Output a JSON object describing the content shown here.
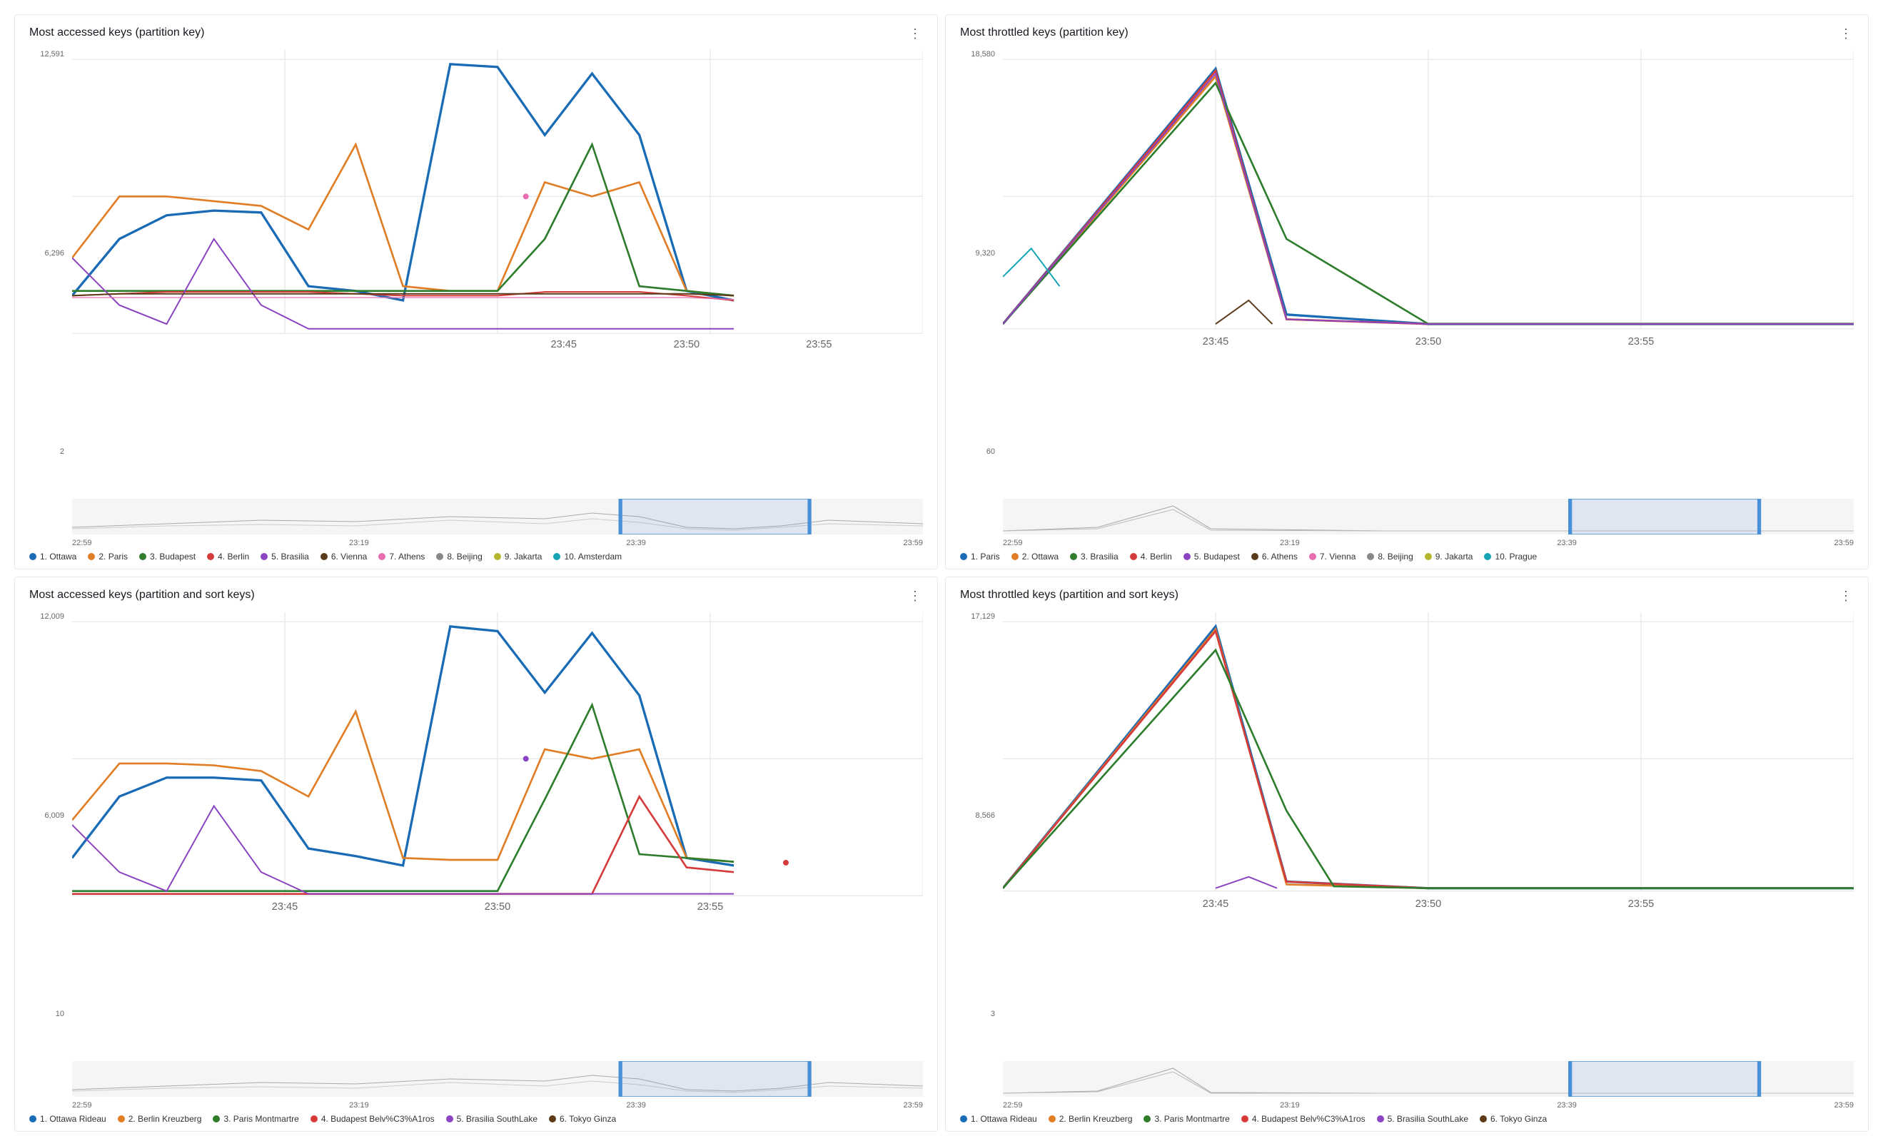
{
  "panels": [
    {
      "id": "panel-top-left",
      "title": "Most accessed keys (partition key)",
      "menu_icon": "⋮",
      "y_axis": [
        "12,591",
        "6,296",
        "2"
      ],
      "x_axis": [
        "22:59",
        "23:19",
        "23:39",
        "23:59"
      ],
      "x_mid": [
        "23:45",
        "23:50",
        "23:55"
      ],
      "legend": [
        {
          "label": "1. Ottawa",
          "color": "#1a6bb5",
          "shape": "dot"
        },
        {
          "label": "2. Paris",
          "color": "#e07d25",
          "shape": "dot"
        },
        {
          "label": "3. Budapest",
          "color": "#2d7d2d",
          "shape": "dot"
        },
        {
          "label": "4. Berlin",
          "color": "#d63b3b",
          "shape": "dot"
        },
        {
          "label": "5. Brasilia",
          "color": "#8b44c1",
          "shape": "dot"
        },
        {
          "label": "6. Vienna",
          "color": "#5c3a1a",
          "shape": "dot"
        },
        {
          "label": "7. Athens",
          "color": "#e86cb0",
          "shape": "dot"
        },
        {
          "label": "8. Beijing",
          "color": "#888",
          "shape": "dot"
        },
        {
          "label": "9. Jakarta",
          "color": "#b5b52d",
          "shape": "dot"
        },
        {
          "label": "10. Amsterdam",
          "color": "#17a5b5",
          "shape": "dot"
        }
      ]
    },
    {
      "id": "panel-top-right",
      "title": "Most throttled keys (partition key)",
      "menu_icon": "⋮",
      "y_axis": [
        "18,580",
        "9,320",
        "60"
      ],
      "x_axis": [
        "22:59",
        "23:19",
        "23:39",
        "23:59"
      ],
      "x_mid": [
        "23:45",
        "23:50",
        "23:55"
      ],
      "legend": [
        {
          "label": "1. Paris",
          "color": "#1a6bb5",
          "shape": "dot"
        },
        {
          "label": "2. Ottawa",
          "color": "#e07d25",
          "shape": "dot"
        },
        {
          "label": "3. Brasilia",
          "color": "#2d7d2d",
          "shape": "dot"
        },
        {
          "label": "4. Berlin",
          "color": "#d63b3b",
          "shape": "dot"
        },
        {
          "label": "5. Budapest",
          "color": "#8b44c1",
          "shape": "dot"
        },
        {
          "label": "6. Athens",
          "color": "#5c3a1a",
          "shape": "dot"
        },
        {
          "label": "7. Vienna",
          "color": "#e86cb0",
          "shape": "dot"
        },
        {
          "label": "8. Beijing",
          "color": "#888",
          "shape": "dot"
        },
        {
          "label": "9. Jakarta",
          "color": "#b5b52d",
          "shape": "dot"
        },
        {
          "label": "10. Prague",
          "color": "#17a5b5",
          "shape": "dot"
        }
      ]
    },
    {
      "id": "panel-bottom-left",
      "title": "Most accessed keys (partition and sort keys)",
      "menu_icon": "⋮",
      "y_axis": [
        "12,009",
        "6,009",
        "10"
      ],
      "x_axis": [
        "22:59",
        "23:19",
        "23:39",
        "23:59"
      ],
      "x_mid": [
        "23:45",
        "23:50",
        "23:55"
      ],
      "legend": [
        {
          "label": "1. Ottawa Rideau",
          "color": "#1a6bb5",
          "shape": "dot"
        },
        {
          "label": "2. Berlin Kreuzberg",
          "color": "#e07d25",
          "shape": "dot"
        },
        {
          "label": "3. Paris Montmartre",
          "color": "#2d7d2d",
          "shape": "dot"
        },
        {
          "label": "4. Budapest Belv%C3%A1ros",
          "color": "#d63b3b",
          "shape": "dot"
        },
        {
          "label": "5. Brasilia SouthLake",
          "color": "#8b44c1",
          "shape": "dot"
        },
        {
          "label": "6. Tokyo Ginza",
          "color": "#5c3a1a",
          "shape": "dot"
        }
      ]
    },
    {
      "id": "panel-bottom-right",
      "title": "Most throttled keys (partition and sort keys)",
      "menu_icon": "⋮",
      "y_axis": [
        "17,129",
        "8,566",
        "3"
      ],
      "x_axis": [
        "22:59",
        "23:19",
        "23:39",
        "23:59"
      ],
      "x_mid": [
        "23:45",
        "23:50",
        "23:55"
      ],
      "legend": [
        {
          "label": "1. Ottawa Rideau",
          "color": "#1a6bb5",
          "shape": "dot"
        },
        {
          "label": "2. Berlin Kreuzberg",
          "color": "#e07d25",
          "shape": "dot"
        },
        {
          "label": "3. Paris Montmartre",
          "color": "#2d7d2d",
          "shape": "dot"
        },
        {
          "label": "4. Budapest Belv%C3%A1ros",
          "color": "#d63b3b",
          "shape": "dot"
        },
        {
          "label": "5. Brasilia SouthLake",
          "color": "#8b44c1",
          "shape": "dot"
        },
        {
          "label": "6. Tokyo Ginza",
          "color": "#5c3a1a",
          "shape": "dot"
        }
      ]
    }
  ]
}
